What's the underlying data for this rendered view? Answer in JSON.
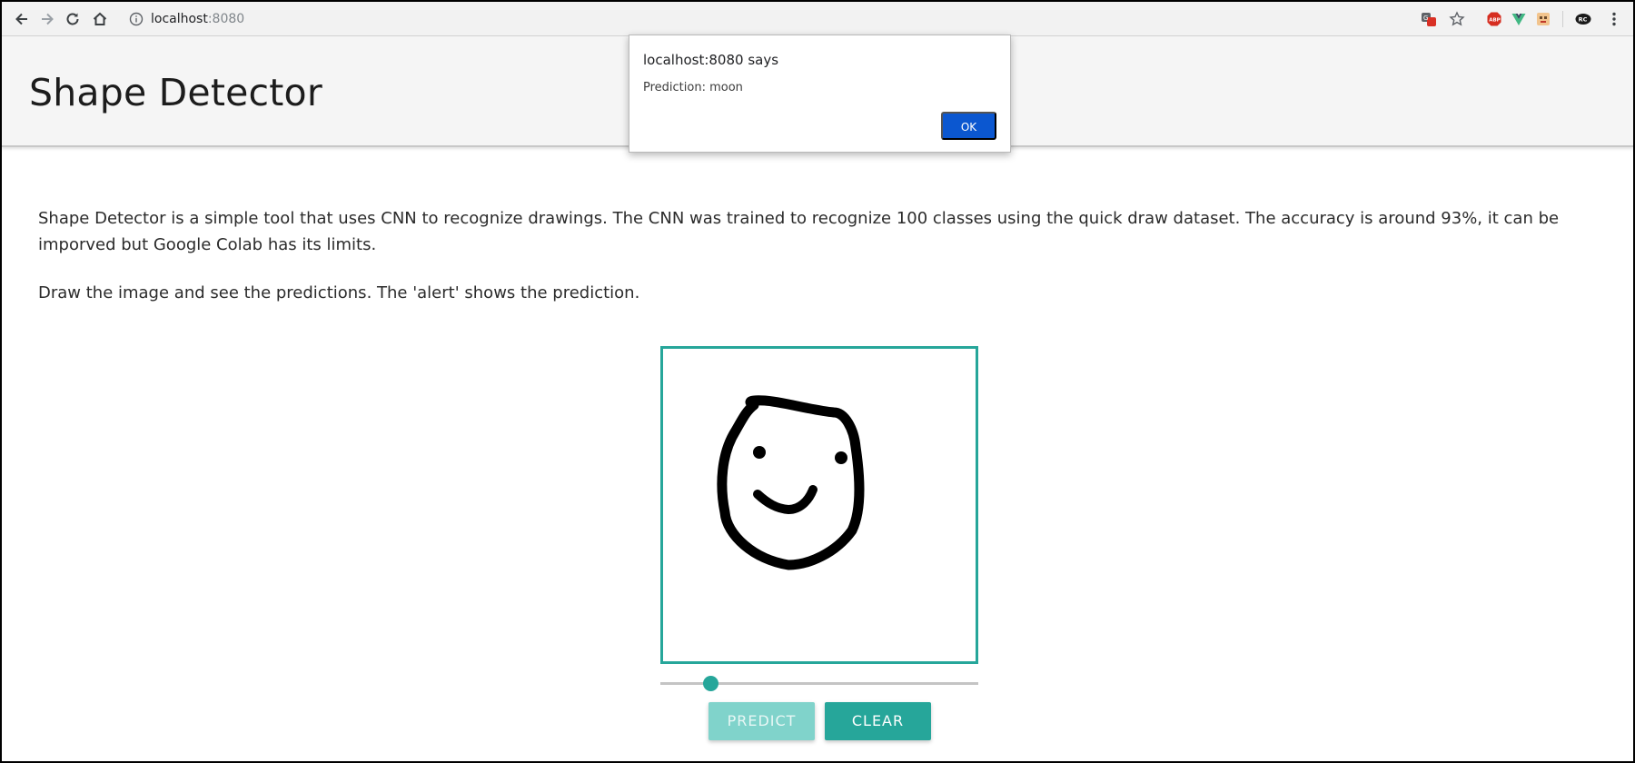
{
  "browser": {
    "url_host": "localhost",
    "url_port": ":8080",
    "icons": [
      "back-icon",
      "forward-icon",
      "reload-icon",
      "home-icon",
      "site-info-icon",
      "translate-icon",
      "bookmark-star-icon",
      "adblock-icon",
      "vue-devtools-icon",
      "extension-icon",
      "rc-extension-icon",
      "menu-icon"
    ]
  },
  "header": {
    "title": "Shape Detector"
  },
  "main": {
    "description": "Shape Detector is a simple tool that uses CNN to recognize drawings. The CNN was trained to recognize 100 classes using the quick draw dataset. The accuracy is around 93%, it can be imporved but Google Colab has its limits.",
    "instructions": "Draw the image and see the predictions. The 'alert' shows the prediction."
  },
  "controls": {
    "predict_label": "PREDICT",
    "clear_label": "CLEAR",
    "brush_level": 0.14
  },
  "alert": {
    "title": "localhost:8080 says",
    "message": "Prediction: moon",
    "ok_label": "OK"
  },
  "colors": {
    "accent": "#26a69a",
    "accent_light": "#80d3cb",
    "dialog_button": "#0b57d0"
  }
}
